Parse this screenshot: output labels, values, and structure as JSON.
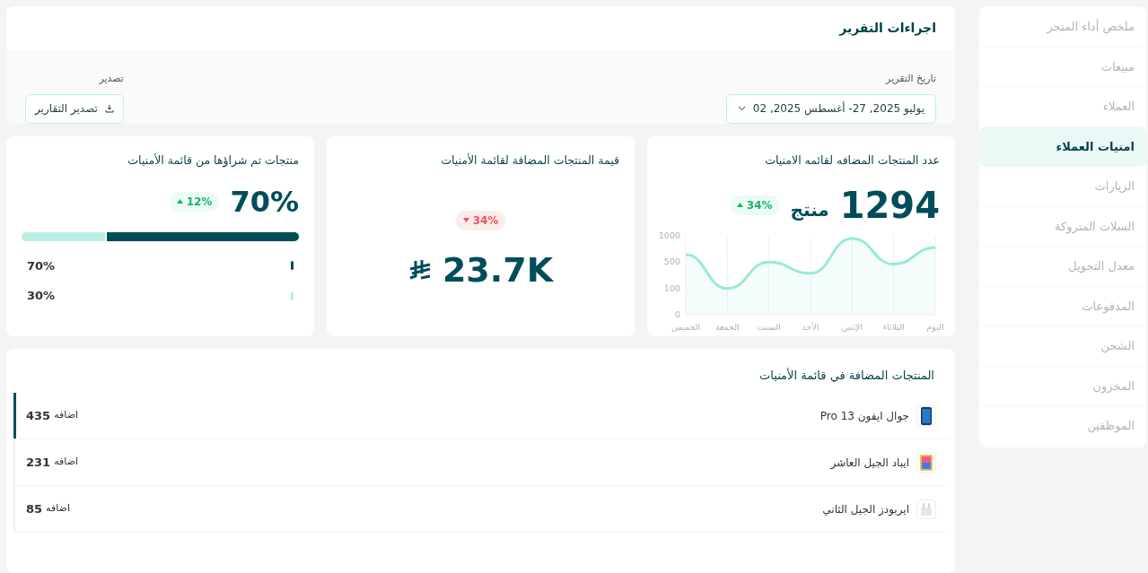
{
  "sidebar": {
    "items": [
      {
        "label": "ملخص أداء المتجر",
        "selected": false
      },
      {
        "label": "مبيعات",
        "selected": false
      },
      {
        "label": "العملاء",
        "selected": false
      },
      {
        "label": "امنيات العملاء",
        "selected": true
      },
      {
        "label": "الزيارات",
        "selected": false
      },
      {
        "label": "السلات المتروكة",
        "selected": false
      },
      {
        "label": "معدل التحويل",
        "selected": false
      },
      {
        "label": "المدفوعات",
        "selected": false
      },
      {
        "label": "الشحن",
        "selected": false
      },
      {
        "label": "المخزون",
        "selected": false
      },
      {
        "label": "الموظفين",
        "selected": false
      }
    ]
  },
  "report_actions": {
    "title": "اجراءات التقرير",
    "date_label": "تاريخ التقرير",
    "date_value": "يوليو 2025, 27- أغسطس 2025, 02",
    "export_label": "تصدير",
    "export_button": "تصدير التقارير"
  },
  "count_card": {
    "title": "عدد المنتجات المضافه لقائمه الامنيات",
    "value": "1294",
    "unit": "منتج",
    "badge": {
      "text": "34%",
      "kind": "up"
    },
    "chart": {
      "x_labels": [
        "اليوم",
        "الثلاثاء",
        "الإثنين",
        "الأحد",
        "السبت",
        "الجمعة",
        "الخميس"
      ],
      "y_labels": [
        "1000",
        "500",
        "100",
        "0"
      ]
    }
  },
  "value_card": {
    "title": "قيمة المنتجات المضافة لقائمة الأمنيات",
    "value": "23.7K",
    "badge": {
      "text": "34%",
      "kind": "down"
    }
  },
  "purchased_card": {
    "title": "منتجات تم شراؤها من قائمة الأمنيات",
    "value": "70%",
    "badge": {
      "text": "12%",
      "kind": "up"
    },
    "progress": {
      "level": 0.7
    },
    "legend": [
      {
        "label": "70%",
        "color": "#004d5a"
      },
      {
        "label": "30%",
        "color": "#b9f0e3"
      }
    ]
  },
  "products": {
    "title": "المنتجات المضافة في قائمة الأمنيات",
    "rows": [
      {
        "name": "جوال ايفون 13 Pro",
        "kind": "phone",
        "count": "435",
        "suffix": "اضافه",
        "selected": true
      },
      {
        "name": "ايباد الجيل العاشر",
        "kind": "tablet",
        "count": "231",
        "suffix": "اضافه",
        "selected": false
      },
      {
        "name": "ايربودز الجيل الثاني",
        "kind": "earbuds",
        "count": "85",
        "suffix": "اضافه",
        "selected": false
      }
    ]
  }
}
